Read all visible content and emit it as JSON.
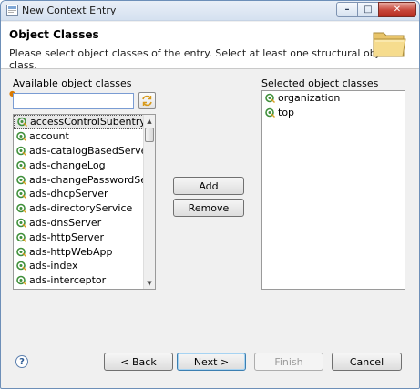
{
  "window": {
    "title": "New Context Entry",
    "minimize_glyph": "–",
    "maximize_glyph": "□",
    "close_glyph": "✕"
  },
  "banner": {
    "title": "Object Classes",
    "message": "Please select object classes of the entry. Select at least one structural object class.",
    "icon": "folder-icon"
  },
  "available": {
    "label": "Available object classes",
    "filter_value": "",
    "filter_placeholder": "",
    "items": [
      "accessControlSubentry",
      "account",
      "ads-catalogBasedServer",
      "ads-changeLog",
      "ads-changePasswordServer",
      "ads-dhcpServer",
      "ads-directoryService",
      "ads-dnsServer",
      "ads-httpServer",
      "ads-httpWebApp",
      "ads-index",
      "ads-interceptor"
    ],
    "selected_index": 0
  },
  "actions": {
    "add_label": "Add",
    "remove_label": "Remove"
  },
  "selected": {
    "label": "Selected object classes",
    "items": [
      "organization",
      "top"
    ]
  },
  "footer": {
    "help_glyph": "?",
    "back_label": "< Back",
    "next_label": "Next >",
    "finish_label": "Finish",
    "cancel_label": "Cancel"
  },
  "colors": {
    "object_class_icon": "#3f8f3a",
    "close_button": "#c7463a",
    "default_button_border": "#3c7fb1"
  }
}
